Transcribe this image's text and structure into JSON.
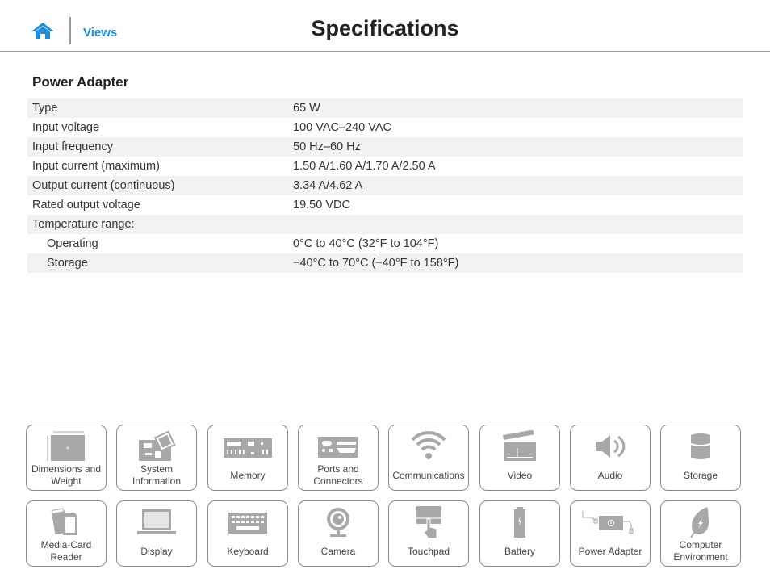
{
  "header": {
    "home_icon": "home-icon",
    "views_link": "Views",
    "title": "Specifications"
  },
  "section": {
    "title": "Power Adapter",
    "rows": [
      {
        "label": "Type",
        "value": "65 W"
      },
      {
        "label": "Input voltage",
        "value": "100 VAC–240 VAC"
      },
      {
        "label": "Input frequency",
        "value": "50 Hz–60 Hz"
      },
      {
        "label": "Input current (maximum)",
        "value": "1.50 A/1.60 A/1.70 A/2.50 A"
      },
      {
        "label": "Output current (continuous)",
        "value": "3.34 A/4.62 A"
      },
      {
        "label": "Rated output voltage",
        "value": "19.50 VDC"
      },
      {
        "label": "Temperature range:",
        "value": ""
      },
      {
        "label": "Operating",
        "value": "0°C to 40°C (32°F to 104°F)"
      },
      {
        "label": "Storage",
        "value": "−40°C to 70°C (−40°F to 158°F)"
      }
    ]
  },
  "nav_tiles": [
    {
      "label_1": "Dimensions and",
      "label_2": "Weight",
      "icon": "dimensions-icon"
    },
    {
      "label_1": "System",
      "label_2": "Information",
      "icon": "system-board-icon"
    },
    {
      "label_1": "Memory",
      "label_2": "",
      "icon": "memory-icon"
    },
    {
      "label_1": "Ports and",
      "label_2": "Connectors",
      "icon": "ports-icon"
    },
    {
      "label_1": "Communications",
      "label_2": "",
      "icon": "wifi-icon"
    },
    {
      "label_1": "Video",
      "label_2": "",
      "icon": "clapperboard-icon"
    },
    {
      "label_1": "Audio",
      "label_2": "",
      "icon": "speaker-icon"
    },
    {
      "label_1": "Storage",
      "label_2": "",
      "icon": "storage-drum-icon"
    },
    {
      "label_1": "Media-Card",
      "label_2": "Reader",
      "icon": "media-card-icon"
    },
    {
      "label_1": "Display",
      "label_2": "",
      "icon": "laptop-display-icon"
    },
    {
      "label_1": "Keyboard",
      "label_2": "",
      "icon": "keyboard-icon"
    },
    {
      "label_1": "Camera",
      "label_2": "",
      "icon": "webcam-icon"
    },
    {
      "label_1": "Touchpad",
      "label_2": "",
      "icon": "touchpad-icon"
    },
    {
      "label_1": "Battery",
      "label_2": "",
      "icon": "battery-icon"
    },
    {
      "label_1": "Power Adapter",
      "label_2": "",
      "icon": "power-adapter-icon"
    },
    {
      "label_1": "Computer",
      "label_2": "Environment",
      "icon": "leaf-icon"
    }
  ],
  "colors": {
    "accent": "#1f8dd6",
    "icon_gray": "#a8a8a8",
    "row_stripe": "#f2f2f2",
    "tile_border": "#8a8a8a"
  }
}
